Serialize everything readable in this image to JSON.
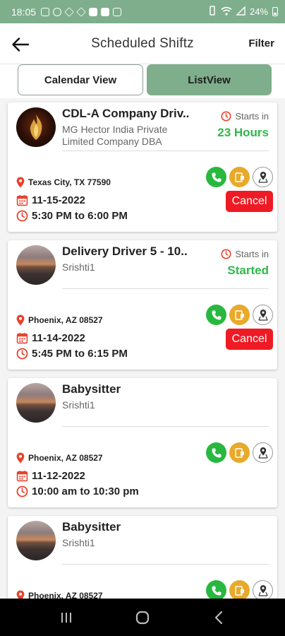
{
  "status_bar": {
    "time": "18:05",
    "battery": "24%",
    "icons": [
      "instagram-icon",
      "telegram-icon",
      "app-icon",
      "app-icon",
      "app-icon",
      "app-icon",
      "app-icon",
      "wifi-icon",
      "signal-icon",
      "battery-icon"
    ]
  },
  "header": {
    "title": "Scheduled Shiftz",
    "filter_label": "Filter",
    "back_icon": "arrow-left-icon"
  },
  "tabs": {
    "calendar_label": "Calendar View",
    "list_label": "ListView",
    "active": "list"
  },
  "colors": {
    "brand_green": "#7fae8c",
    "started_green": "#2fb84a",
    "cancel_red": "#ef1b24",
    "icon_red": "#e8432e",
    "phone_green": "#28b83f",
    "chat_orange": "#e9a92a"
  },
  "shifts": [
    {
      "title": "CDL-A Company Driv..",
      "company": "MG Hector India Private Limited Company DBA",
      "starts_label": "Starts in",
      "status": "23 Hours",
      "location": "Texas City, TX 77590",
      "date": "11-15-2022",
      "time": "5:30 PM to 6:00 PM",
      "cancel_label": "Cancel"
    },
    {
      "title": "Delivery Driver 5 - 10..",
      "company": "Srishti1",
      "starts_label": "Starts in",
      "status": "Started",
      "location": "Phoenix, AZ 08527",
      "date": "11-14-2022",
      "time": "5:45 PM to 6:15 PM",
      "cancel_label": "Cancel"
    },
    {
      "title": "Babysitter",
      "company": "Srishti1",
      "location": "Phoenix, AZ 08527",
      "date": "11-12-2022",
      "time": "10:00 am to 10:30 pm"
    },
    {
      "title": "Babysitter",
      "company": "Srishti1",
      "location": "Phoenix, AZ 08527"
    }
  ],
  "nav_bar": {
    "buttons": [
      "recent-apps-icon",
      "home-icon",
      "back-icon"
    ]
  }
}
